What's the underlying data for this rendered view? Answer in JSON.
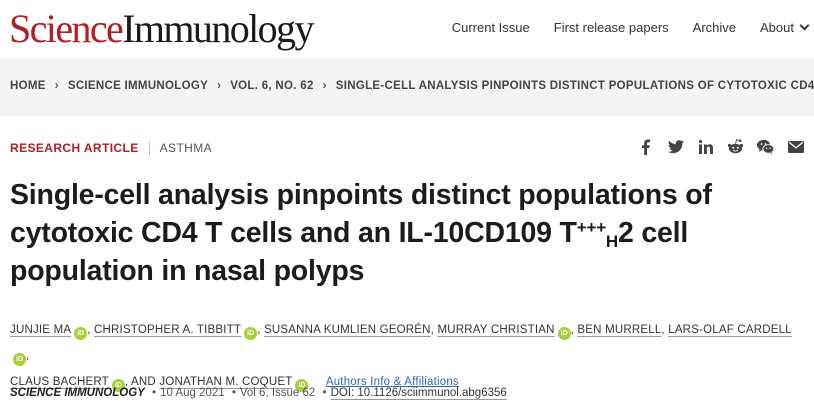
{
  "header": {
    "logo_science": "Science",
    "logo_journal": "Immunology",
    "nav": [
      "Current Issue",
      "First release papers",
      "Archive"
    ],
    "about": "About"
  },
  "breadcrumb": [
    "HOME",
    "SCIENCE IMMUNOLOGY",
    "VOL. 6, NO. 62",
    "SINGLE-CELL ANALYSIS PINPOINTS DISTINCT POPULATIONS OF CYTOTOXIC CD4 ..."
  ],
  "article": {
    "type": "RESEARCH ARTICLE",
    "topic": "ASTHMA",
    "title_part1": "Single-cell analysis pinpoints distinct populations of cytotoxic CD4 T cells and an IL-10CD109 T",
    "title_sup": "+++",
    "title_sub": "H",
    "title_part2": "2 cell population in nasal polyps"
  },
  "share_icons": [
    "facebook-icon",
    "twitter-icon",
    "linkedin-icon",
    "reddit-icon",
    "wechat-icon",
    "email-icon"
  ],
  "authors": [
    "JUNJIE MA",
    "CHRISTOPHER A. TIBBITT",
    "SUSANNA KUMLIEN GEORÉN",
    "MURRAY CHRISTIAN",
    "BEN MURRELL",
    "LARS-OLAF CARDELL",
    "CLAUS BACHERT",
    "JONATHAN M. COQUET"
  ],
  "orcid_label": "iD",
  "and_text": "AND",
  "affiliations_link": "Authors Info & Affiliations",
  "citation": {
    "journal": "SCIENCE IMMUNOLOGY",
    "date": "10 Aug 2021",
    "volume": "Vol 6, Issue 62",
    "doi": "DOI: 10.1126/sciimmunol.abg6356"
  },
  "colors": {
    "brand": "#b01f24",
    "orcid": "#a6ce39",
    "link": "#2b6cb0"
  }
}
